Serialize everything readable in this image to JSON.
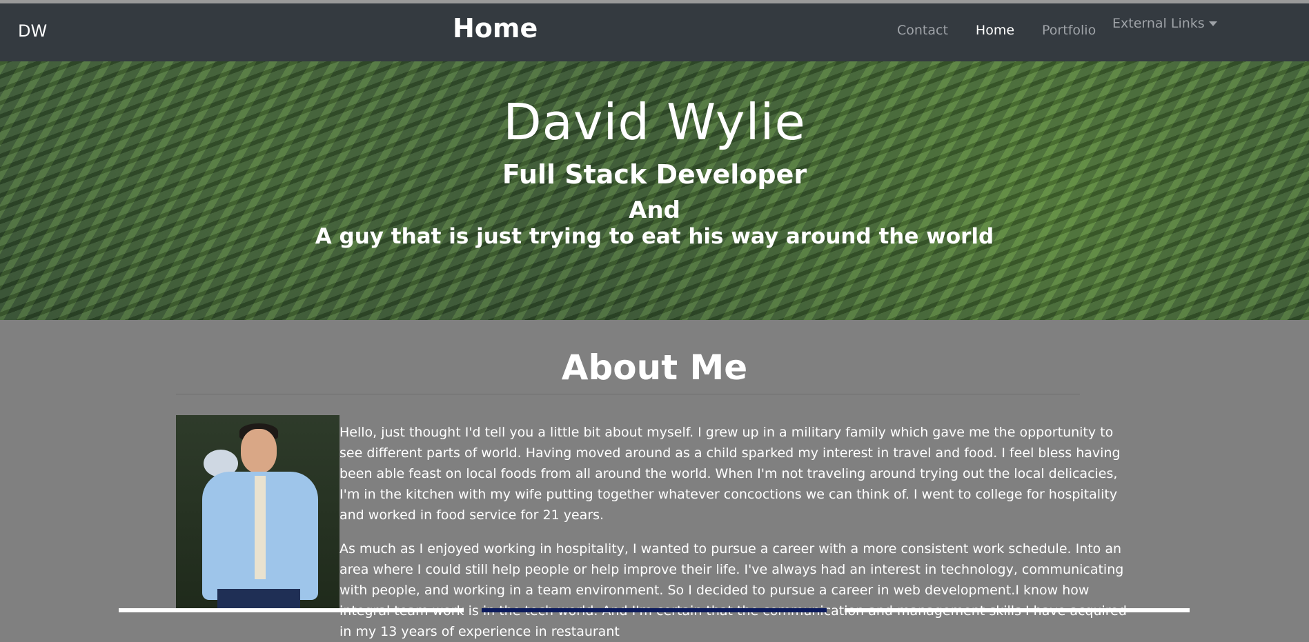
{
  "navbar": {
    "brand": "DW",
    "title": "Home",
    "links": [
      {
        "label": "Contact",
        "active": false
      },
      {
        "label": "Home",
        "active": true
      },
      {
        "label": "Portfolio",
        "active": false
      }
    ],
    "dropdown_label": "External Links"
  },
  "hero": {
    "name": "David Wylie",
    "role": "Full Stack Developer",
    "and": "And",
    "tagline": "A guy that is just trying to eat his way around the world"
  },
  "about": {
    "title": "About Me",
    "paragraphs": [
      "Hello, just thought I'd tell you a little bit about myself. I grew up in a military family which gave me the opportunity to see different parts of world. Having moved around as a child sparked my interest in travel and food. I feel bless having been able feast on local foods from all around the world. When I'm not traveling around trying out the local delicacies, I'm in the kitchen with my wife putting together whatever concoctions we can think of. I went to college for hospitality and worked in food service for 21 years.",
      "As much as I enjoyed working in hospitality, I wanted to pursue a career with a more consistent work schedule. Into an area where I could still help people or help improve their life. I've always had an interest in technology, communicating with people, and working in a team environment. So I decided to pursue a career in web development.I know how integral team work is in the tech world. And I'm certain that the communication and management skills I have acquired in my 13 years of experience in restaurant"
    ]
  },
  "colors": {
    "navbar_bg": "#343a40",
    "nav_inactive": "#9fa3a8",
    "section_bg": "#808080"
  }
}
